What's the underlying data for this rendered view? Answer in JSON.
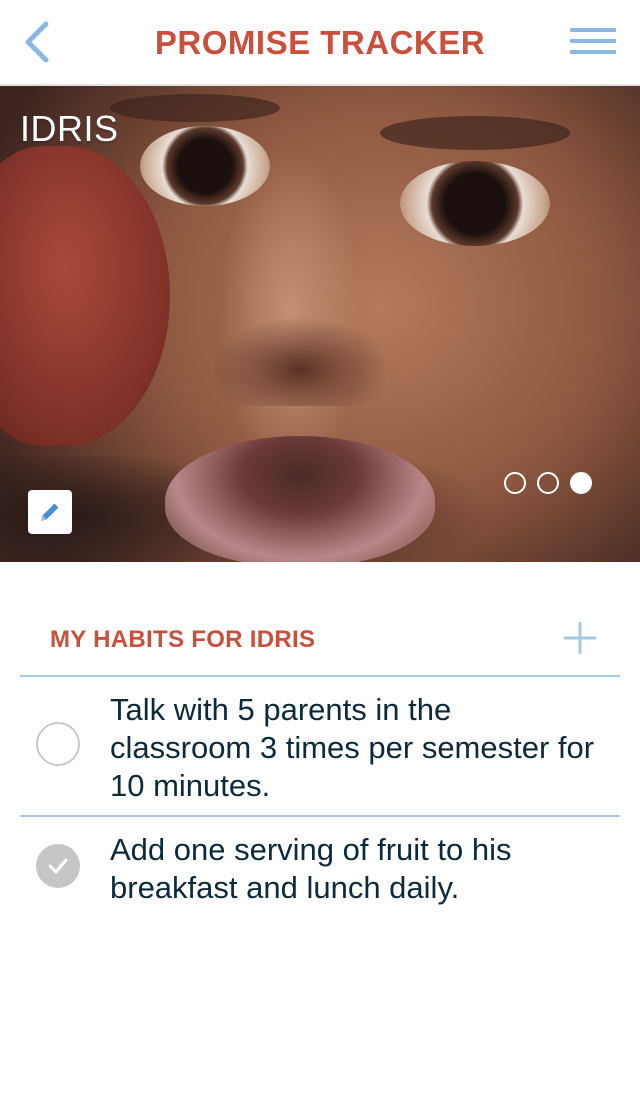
{
  "header": {
    "brand": "PROMISE TRACKER",
    "back_icon": "chevron-left-icon",
    "menu_icon": "hamburger-menu-icon",
    "accent_color": "#c8503d",
    "icon_color": "#8bb8e0"
  },
  "hero": {
    "name": "IDRIS",
    "photo_description_icon": "child-photo",
    "carousel": {
      "total": 3,
      "active_index": 3
    },
    "edit_icon": "pencil-icon"
  },
  "habits": {
    "title": "MY HABITS FOR IDRIS",
    "add_icon": "plus-icon",
    "items": [
      {
        "text": "Talk with 5 parents in the classroom 3 times per semester for 10 minutes.",
        "completed": false
      },
      {
        "text": "Add one serving of fruit to his breakfast and lunch daily.",
        "completed": true
      }
    ]
  }
}
